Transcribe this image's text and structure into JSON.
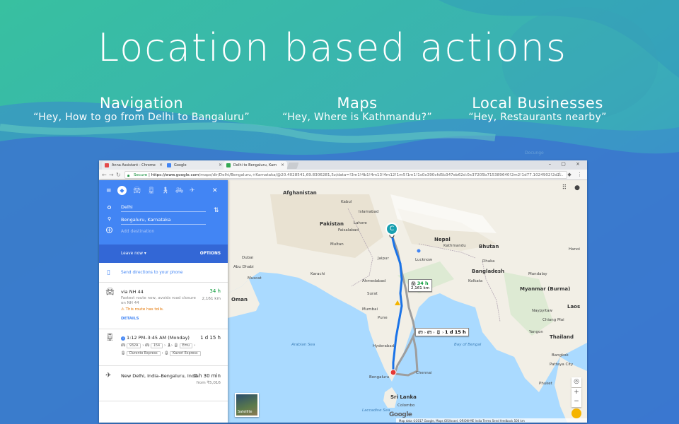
{
  "slide": {
    "title": "Location based actions",
    "features": [
      {
        "heading": "Navigation",
        "query": "“Hey, How to go from Delhi to Bangaluru”"
      },
      {
        "heading": "Maps",
        "query": "“Hey, Where is Kathmandu?”"
      },
      {
        "heading": "Local Businesses",
        "query": "“Hey, Restaurants nearby”"
      }
    ],
    "brand": "Docungo"
  },
  "browser": {
    "tabs": [
      {
        "label": "Anna Assistant - Chrome",
        "close": "×"
      },
      {
        "label": "Google",
        "close": "×"
      },
      {
        "label": "Delhi to Bengaluru, Karn",
        "close": "×"
      }
    ],
    "window_buttons": "– ▢ ×",
    "secure_label": "Secure",
    "url_host": "https://www.google.com",
    "url_path": "/maps/dir/Delhi/Bengaluru,+Karnataka/@20.4028541,69.8306281,5z/data=!3m1!4b1!4m13!4m12!1m5!1m1!1s0x390cfd5b347eb62d:0x37205b715389640!2m2!1d77.1024902!2d2..."
  },
  "directions": {
    "origin": "Delhi",
    "destination": "Bengaluru, Karnataka",
    "add_destination": "Add destination",
    "leave_now": "Leave now ▾",
    "options": "OPTIONS",
    "send_to_phone": "Send directions to your phone",
    "routes": [
      {
        "type": "drive",
        "name": "via NH 44",
        "time": "34 h",
        "distance": "2,161 km",
        "note": "Fastest route now, avoids road closure on NH 44",
        "warning": "⚠ This route has tolls.",
        "details": "DETAILS"
      },
      {
        "type": "train",
        "name": "1:12 PM–3:45 AM (Monday)",
        "time": "1 d 15 h",
        "chips_row1": [
          "932A",
          "154",
          "Emu"
        ],
        "chips_row2": [
          "Duronto Express",
          "Kaveri Express"
        ]
      },
      {
        "type": "flight",
        "name": "New Delhi, India–Bengaluru, India",
        "time": "2 h 30 min",
        "price": "from ₹5,016"
      }
    ]
  },
  "map": {
    "labels": {
      "afghanistan": "Afghanistan",
      "pakistan": "Pakistan",
      "nepal": "Nepal",
      "bhutan": "Bhutan",
      "bangladesh": "Bangladesh",
      "myanmar": "Myanmar\n(Burma)",
      "laos": "Laos",
      "thailand": "Thailand",
      "srilanka": "Sri Lanka",
      "oman": "Oman",
      "india_cities": [
        "Kabul",
        "Islamabad",
        "Lahore",
        "Faisalabad",
        "Multan",
        "Karachi",
        "Jaipur",
        "Lucknow",
        "Kathmandu",
        "Dhaka",
        "Kolkata",
        "Ahmedabad",
        "Surat",
        "Mumbai",
        "Pune",
        "Hyderabad",
        "Chennai",
        "Bengaluru",
        "Colombo",
        "Yangon",
        "Bangkok",
        "Naypyitaw",
        "Dubai",
        "Abu Dhabi",
        "Muscat",
        "Mandalay",
        "Hanoi",
        "Chiang Mai",
        "Pattaya City",
        "Phuket"
      ],
      "arabian_sea": "Arabian Sea",
      "bay_of_bengal": "Bay of Bengal",
      "laccadive_sea": "Laccadive Sea"
    },
    "callout_drive": {
      "time": "34 h",
      "distance": "2,161 km"
    },
    "callout_train": "1 d 15 h",
    "marker_origin": "C",
    "satellite": "Satellite",
    "google": "Google",
    "attribution": "Map data ©2017 Google, Maps GIS/Israel, ORION-ME   India   Terms   Send feedback   500 km"
  },
  "colors": {
    "blue_panel": "#4285f4",
    "route": "#1a73e8",
    "accent_green": "#0c9b3b"
  }
}
